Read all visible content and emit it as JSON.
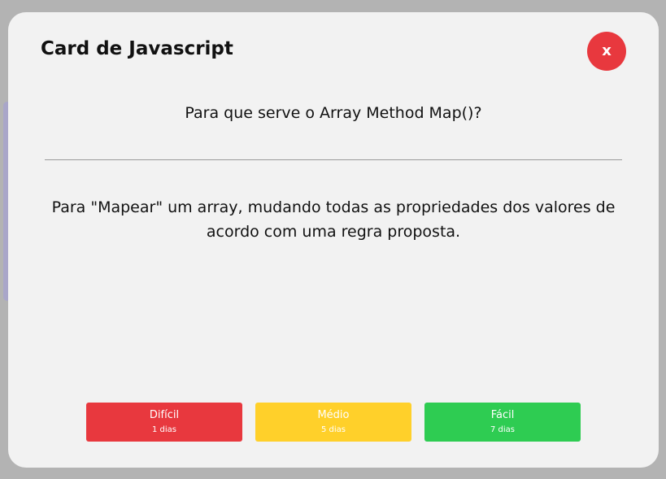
{
  "modal": {
    "title": "Card de Javascript",
    "close_label": "x"
  },
  "card": {
    "question": "Para que serve o Array Method Map()?",
    "answer": "Para \"Mapear\" um array, mudando todas as propriedades dos valores de acordo com uma regra proposta."
  },
  "difficulty": [
    {
      "label": "Difícil",
      "days": "1 dias",
      "color": "#e8383e"
    },
    {
      "label": "Médio",
      "days": "5 dias",
      "color": "#ffd02a"
    },
    {
      "label": "Fácil",
      "days": "7 dias",
      "color": "#2ecc52"
    }
  ]
}
